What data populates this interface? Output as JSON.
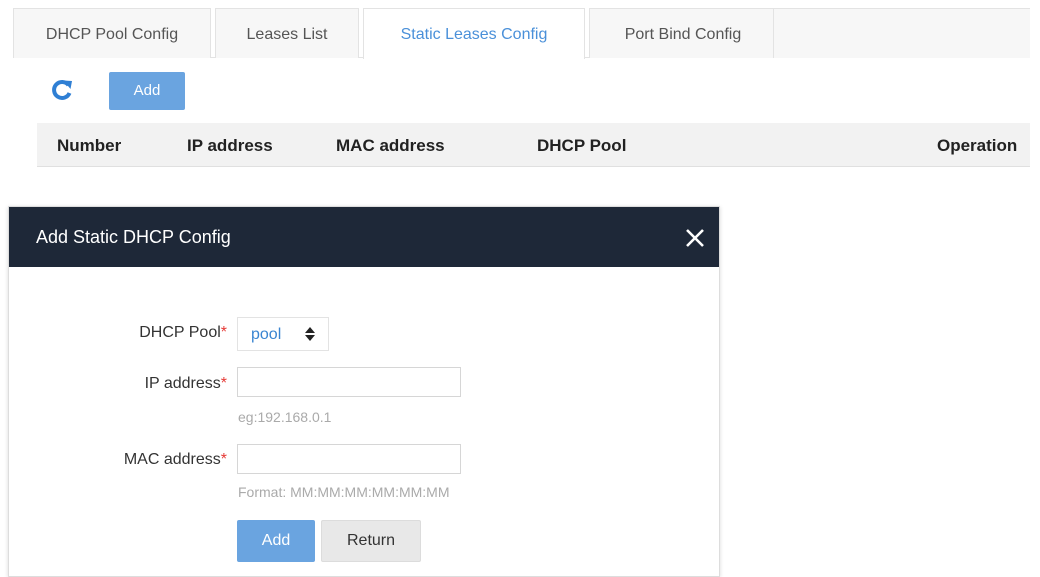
{
  "tabs": [
    {
      "label": "DHCP Pool Config",
      "active": false
    },
    {
      "label": "Leases List",
      "active": false
    },
    {
      "label": "Static Leases Config",
      "active": true
    },
    {
      "label": "Port Bind Config",
      "active": false
    }
  ],
  "toolbar": {
    "refresh_icon": "refresh-icon",
    "add_label": "Add"
  },
  "table": {
    "columns": [
      "Number",
      "IP address",
      "MAC address",
      "DHCP Pool",
      "Operation"
    ],
    "rows": []
  },
  "modal": {
    "title": "Add Static DHCP Config",
    "close_icon": "close-icon",
    "fields": {
      "pool": {
        "label": "DHCP Pool",
        "required_mark": "*",
        "value": "pool"
      },
      "ip": {
        "label": "IP address",
        "required_mark": "*",
        "value": "",
        "hint": "eg:192.168.0.1"
      },
      "mac": {
        "label": "MAC address",
        "required_mark": "*",
        "value": "",
        "hint": "Format: MM:MM:MM:MM:MM:MM"
      }
    },
    "add_label": "Add",
    "return_label": "Return"
  },
  "colors": {
    "accent": "#4a90d9",
    "button_primary": "#6aa4e0",
    "modal_header": "#1e2838",
    "required": "#e53935"
  }
}
